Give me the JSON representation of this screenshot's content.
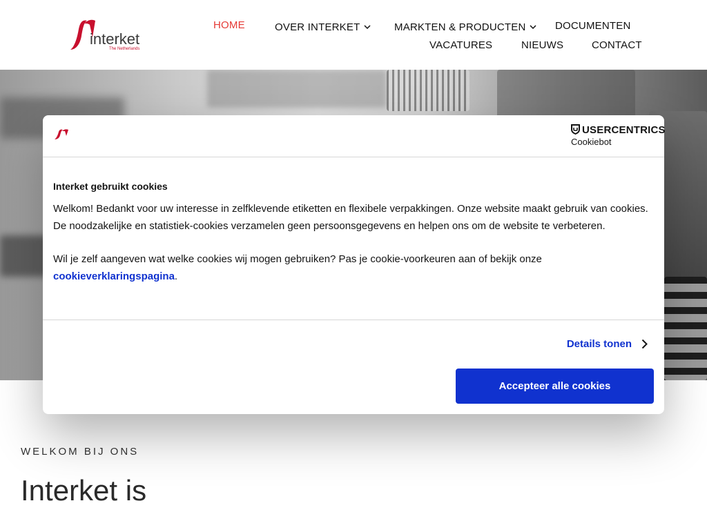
{
  "header": {
    "logo": {
      "wordmark": "interket",
      "tagline": "The Netherlands"
    },
    "nav": {
      "home": "HOME",
      "over": "OVER INTERKET",
      "markten": "MARKTEN & PRODUCTEN",
      "documenten": "DOCUMENTEN",
      "vacatures": "VACATURES",
      "nieuws": "NIEUWS",
      "contact": "CONTACT"
    }
  },
  "main": {
    "welcome_label": "WELKOM BIJ ONS",
    "welcome_title": "Interket is"
  },
  "cookie_dialog": {
    "brand": {
      "name": "USERCENTRICS",
      "product": "Cookiebot"
    },
    "title": "Interket gebruikt cookies",
    "paragraph1": "Welkom! Bedankt voor uw interesse in zelfklevende etiketten en flexibele verpakkingen. Onze website maakt gebruik van cookies. De noodzakelijke en statistiek-cookies verzamelen geen persoonsgegevens en helpen ons om de website te verbeteren.",
    "paragraph2_prefix": "Wil je zelf aangeven wat welke cookies wij mogen gebruiken? Pas je cookie-voorkeuren aan of bekijk onze ",
    "link_text": "cookieverklaringspagina",
    "paragraph2_suffix": ".",
    "details_label": "Details tonen",
    "accept_label": "Accepteer alle cookies"
  },
  "colors": {
    "accent_red": "#e53935",
    "brand_red": "#c8102e",
    "primary_blue": "#1032cf"
  },
  "icons": [
    "interket-logo",
    "chevron-down-icon",
    "shield-icon",
    "chevron-right-icon"
  ]
}
